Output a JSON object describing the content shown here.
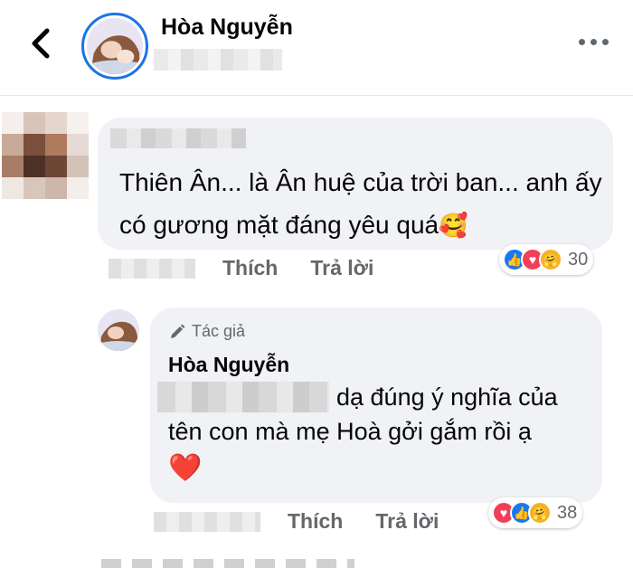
{
  "header": {
    "name": "Hòa Nguyễn",
    "back_icon": "chevron-left-icon",
    "more_icon": "more-horizontal-icon"
  },
  "comment": {
    "text": "Thiên Ân... là Ân huệ của trời ban... anh ấy có gương mặt đáng yêu quá",
    "emoji": "🥰",
    "actions": {
      "like": "Thích",
      "reply": "Trả lời"
    },
    "reactions": {
      "icons": [
        "like",
        "love",
        "care"
      ],
      "count": "30"
    }
  },
  "reply": {
    "badge": "Tác giả",
    "author": "Hòa Nguyễn",
    "text": "dạ đúng ý nghĩa của tên con mà mẹ Hoà gởi gắm rồi ạ",
    "heart": "❤️",
    "actions": {
      "like": "Thích",
      "reply": "Trả lời"
    },
    "reactions": {
      "icons": [
        "love",
        "like",
        "care"
      ],
      "count": "38"
    }
  },
  "colors": {
    "accent": "#1b74e4",
    "bubble": "#f0f2f5",
    "meta": "#65676b"
  }
}
